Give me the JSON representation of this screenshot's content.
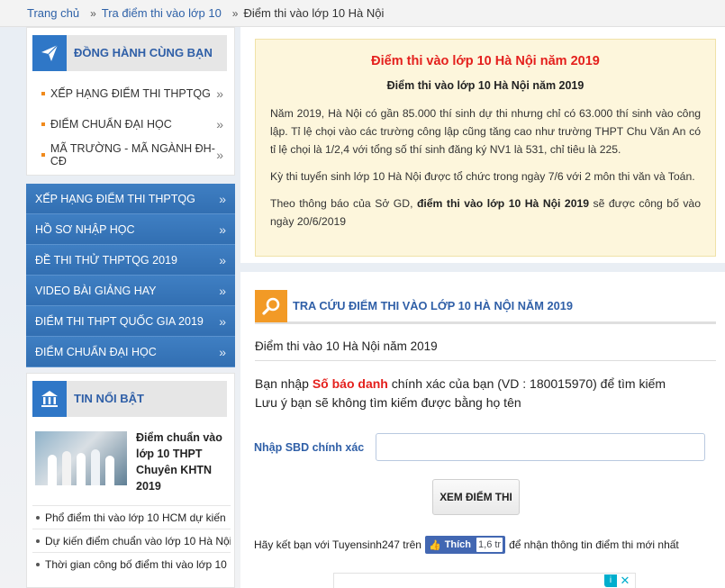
{
  "breadcrumb": {
    "items": [
      "Trang chủ",
      "Tra điểm thi vào lớp 10"
    ],
    "current": "Điểm thi vào lớp 10 Hà Nội"
  },
  "companion": {
    "title": "ĐỒNG HÀNH CÙNG BẠN",
    "items": [
      "XẾP HẠNG ĐIỂM THI THPTQG",
      "ĐIỂM CHUẨN ĐẠI HỌC",
      "MÃ TRƯỜNG - MÃ NGÀNH ĐH-CĐ"
    ]
  },
  "blue_menu": [
    "XẾP HẠNG ĐIỂM THI THPTQG",
    "HỒ SƠ NHẬP HỌC",
    "ĐỀ THI THỬ THPTQG 2019",
    "VIDEO BÀI GIẢNG HAY",
    "ĐIỂM THI THPT QUỐC GIA 2019",
    "ĐIỂM CHUẨN ĐẠI HỌC"
  ],
  "featured": {
    "title": "TIN NỔI BẬT",
    "headline": "Điểm chuẩn vào lớp 10 THPT Chuyên KHTN 2019",
    "links": [
      "Phổ điểm thi vào lớp 10 HCM dự kiến",
      "Dự kiến điểm chuẩn vào lớp 10 Hà Nội",
      "Thời gian công bố điểm thi vào lớp 10"
    ]
  },
  "notice": {
    "title": "Điểm thi vào lớp 10 Hà Nội năm 2019",
    "subtitle": "Điểm thi vào lớp 10 Hà Nội năm 2019",
    "p1": "Năm 2019, Hà Nội có gần 85.000 thí sinh dự thi nhưng chỉ có 63.000 thí sinh vào công lập. Tỉ lệ chọi vào các trường công lập cũng tăng cao như trường THPT Chu Văn An có tỉ lệ chọi là 1/2,4 với tổng số thí sinh đăng ký NV1 là 531, chỉ tiêu là 225.",
    "p2": "Kỳ thi tuyển sinh lớp 10 Hà Nội được tổ chức trong ngày 7/6 với 2 môn thi văn và Toán.",
    "p3_pre": "Theo thông báo của Sở GD, ",
    "p3_bold": "điểm thi vào lớp 10 Hà Nội 2019",
    "p3_post": " sẽ được công bố vào ngày 20/6/2019"
  },
  "lookup": {
    "title": "TRA CỨU ĐIỂM THI VÀO LỚP 10 HÀ NỘI NĂM 2019",
    "subtitle": "Điểm thi vào 10 Hà Nội năm 2019",
    "inst_pre": "Bạn nhập ",
    "inst_highlight": "Số báo danh",
    "inst_post": " chính xác của bạn (VD : 180015970) để tìm kiếm",
    "inst_line2": "Lưu ý bạn sẽ không tìm kiếm được bằng họ tên",
    "input_label": "Nhập SBD chính xác",
    "input_value": "",
    "button_label": "XEM ĐIỂM THI",
    "social_pre": "Hãy kết bạn với Tuyensinh247 trên",
    "like_label": "Thích",
    "like_count": "1,6 tr",
    "social_post": "để nhận thông tin điểm thi mới nhất"
  },
  "colors": {
    "accent_blue": "#2f77c7",
    "accent_orange": "#f29a26",
    "highlight_red": "#e4201d"
  }
}
